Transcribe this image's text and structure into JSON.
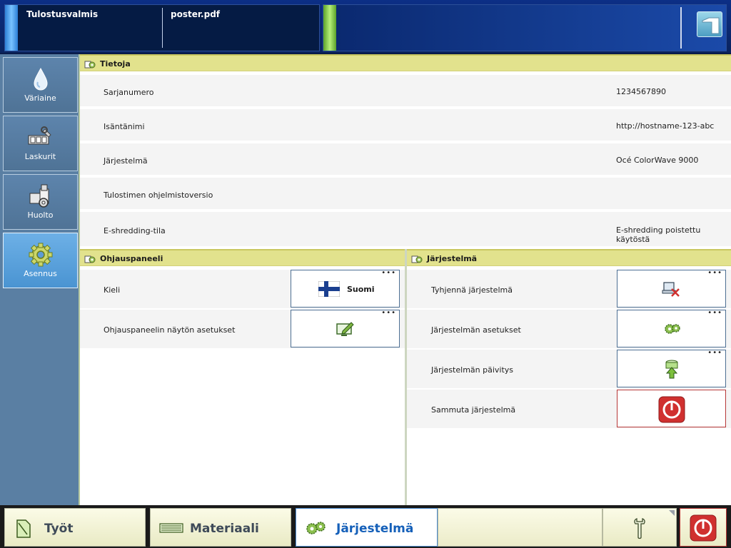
{
  "status": {
    "printer_state": "Tulostusvalmis",
    "current_job": "poster.pdf"
  },
  "sidebar": {
    "items": [
      {
        "label": "Väriaine",
        "icon": "ink-drop-icon",
        "active": false
      },
      {
        "label": "Laskurit",
        "icon": "counter-icon",
        "active": false
      },
      {
        "label": "Huolto",
        "icon": "maintenance-icon",
        "active": false
      },
      {
        "label": "Asennus",
        "icon": "gear-icon",
        "active": true
      }
    ]
  },
  "info": {
    "title": "Tietoja",
    "rows": [
      {
        "label": "Sarjanumero",
        "value": "1234567890"
      },
      {
        "label": "Isäntänimi",
        "value": "http://hostname-123-abc"
      },
      {
        "label": "Järjestelmä",
        "value": "Océ ColorWave 9000"
      },
      {
        "label": "Tulostimen ohjelmistoversio",
        "value": ""
      },
      {
        "label": "E-shredding-tila",
        "value": "E-shredding poistettu käytöstä"
      }
    ]
  },
  "control_panel": {
    "title": "Ohjauspaneeli",
    "rows": [
      {
        "label": "Kieli",
        "button_text": "Suomi"
      },
      {
        "label": "Ohjauspaneelin näytön asetukset",
        "button_text": ""
      }
    ]
  },
  "system": {
    "title": "Järjestelmä",
    "rows": [
      {
        "label": "Tyhjennä järjestelmä"
      },
      {
        "label": "Järjestelmän asetukset"
      },
      {
        "label": "Järjestelmän päivitys"
      },
      {
        "label": "Sammuta järjestelmä"
      }
    ]
  },
  "more_glyph": "•••",
  "tabs": [
    {
      "label": "Työt",
      "active": false
    },
    {
      "label": "Materiaali",
      "active": false
    },
    {
      "label": "Järjestelmä",
      "active": true
    }
  ],
  "colors": {
    "section_header": "#e2e28d",
    "active_nav": "#4a94d2",
    "active_tab_text": "#1560b9",
    "power_red": "#d0302f"
  }
}
